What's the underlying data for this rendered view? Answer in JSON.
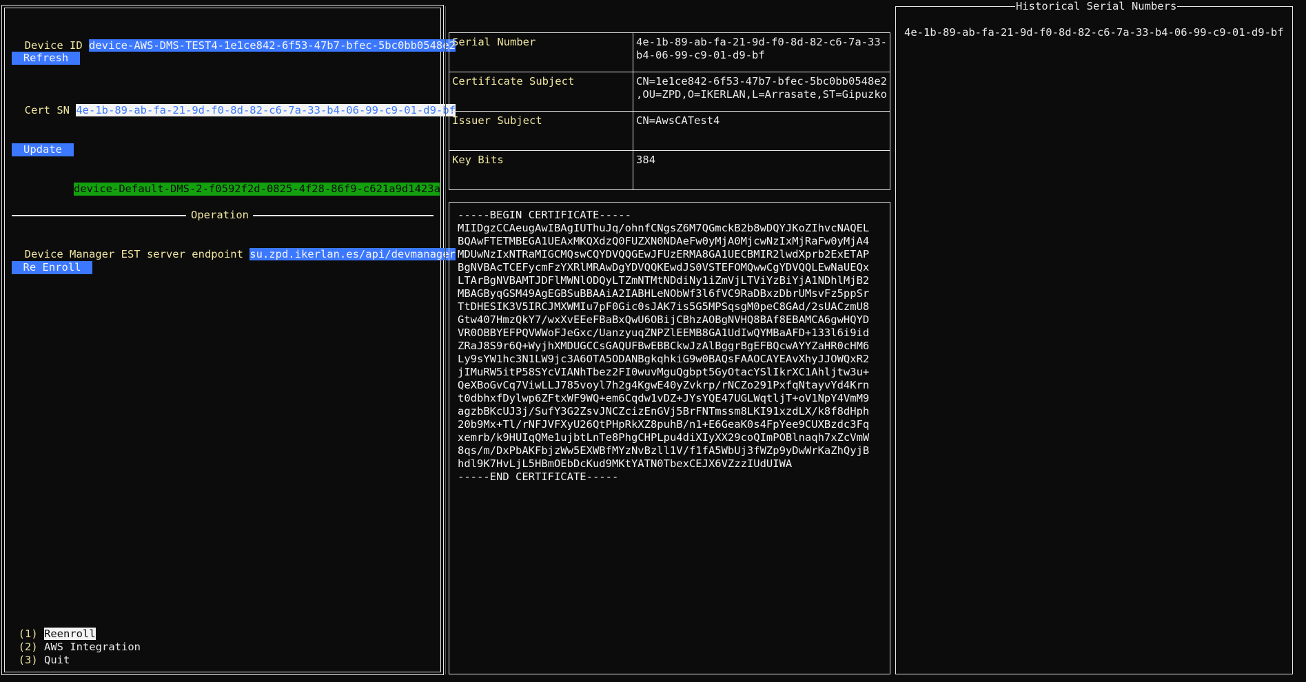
{
  "left": {
    "device_id_label": "Device ID",
    "device_id_value": "device-AWS-DMS-TEST4-1e1ce842-6f53-47b7-bfec-5bc0bb0548e2",
    "refresh_label": "Refresh",
    "cert_sn_label": "Cert SN",
    "cert_sn_value": "4e-1b-89-ab-fa-21-9d-f0-8d-82-c6-7a-33-b4-06-99-c9-01-d9-bf",
    "update_label": "Update",
    "green_value": "device-Default-DMS-2-f0592f2d-0825-4f28-86f9-c621a9d1423a",
    "operation_title": "Operation",
    "endpoint_label": "Device Manager EST server endpoint",
    "endpoint_value": "su.zpd.ikerlan.es/api/devmanager",
    "reenroll_button": "Re Enroll",
    "menu": [
      {
        "key": "(1)",
        "label": "Reenroll"
      },
      {
        "key": "(2)",
        "label": "AWS Integration"
      },
      {
        "key": "(3)",
        "label": "Quit"
      }
    ]
  },
  "info": {
    "rows": [
      {
        "label": "Serial Number",
        "value": "4e-1b-89-ab-fa-21-9d-f0-8d-82-c6-7a-33-\nb4-06-99-c9-01-d9-bf"
      },
      {
        "label": "Certificate Subject",
        "value": "CN=1e1ce842-6f53-47b7-bfec-5bc0bb0548e2\n,OU=ZPD,O=IKERLAN,L=Arrasate,ST=Gipuzko"
      },
      {
        "label": "Issuer Subject",
        "value": "CN=AwsCATest4"
      },
      {
        "label": "Key Bits",
        "value": "384"
      }
    ]
  },
  "certificate": {
    "lines": [
      "-----BEGIN CERTIFICATE-----",
      "MIIDgzCCAeugAwIBAgIUThuJq/ohnfCNgsZ6M7QGmckB2b8wDQYJKoZIhvcNAQEL",
      "BQAwFTETMBEGA1UEAxMKQXdzQ0FUZXN0NDAeFw0yMjA0MjcwNzIxMjRaFw0yMjA4",
      "MDUwNzIxNTRaMIGCMQswCQYDVQQGEwJFUzERMA8GA1UECBMIR2lwdXprb2ExETAP",
      "BgNVBAcTCEFycmFzYXRlMRAwDgYDVQQKEwdJS0VSTEFOMQwwCgYDVQQLEwNaUEQx",
      "LTArBgNVBAMTJDFlMWNlODQyLTZmNTMtNDdiNy1iZmVjLTViYzBiYjA1NDhlMjB2",
      "MBAGByqGSM49AgEGBSuBBAAiA2IABHLeNObWf3l6fVC9RaDBxzDbrUMsvFz5ppSr",
      "TtDHESIK3V5IRCJMXWMIu7pF0Gic0sJAK7is5G5MPSqsgM0peC8GAd/2sUACzmU8",
      "Gtw407HmzQkY7/wxXvEEeFBaBxQwU6OBijCBhzAOBgNVHQ8BAf8EBAMCA6gwHQYD",
      "VR0OBBYEFPQVWWoFJeGxc/UanzyuqZNPZlEEMB8GA1UdIwQYMBaAFD+133l6i9id",
      "ZRaJ8S9r6Q+WyjhXMDUGCCsGAQUFBwEBBCkwJzAlBggrBgEFBQcwAYYZaHR0cHM6",
      "Ly9sYW1hc3N1LW9jc3A6OTA5ODANBgkqhkiG9w0BAQsFAAOCAYEAvXhyJJOWQxR2",
      "jIMuRW5itP58SYcVIANhTbez2FI0wuvMguQgbpt5GyOtacYSlIkrXC1Ahljtw3u+",
      "QeXBoGvCq7ViwLLJ785voyl7h2g4KgwE40yZvkrp/rNCZo291PxfqNtayvYd4Krn",
      "t0dbhxfDylwp6ZFtxWF9WQ+em6Cqdw1vDZ+JYsYQE47UGLWqtljT+oV1NpY4VmM9",
      "agzbBKcUJ3j/SufY3G2ZsvJNCZcizEnGVj5BrFNTmssm8LKI91xzdLX/k8f8dHph",
      "20b9Mx+Tl/rNFJVFXyU26QtPHpRkXZ8puhB/n1+E6GeaK0s4FpYee9CUXBzdc3Fq",
      "xemrb/k9HUIqQMe1ujbtLnTe8PhgCHPLpu4diXIyXX29coQImPOBlnaqh7xZcVmW",
      "8qs/m/DxPbAKFbjzWw5EXWBfMYzNvBzll1V/f1fA5WbUj3fWZp9yDwWrKaZhQyjB",
      "hdl9K7HvLjL5HBmOEbDcKud9MKtYATN0TbexCEJX6VZzzIUdUIWA",
      "-----END CERTIFICATE-----"
    ]
  },
  "history": {
    "title": "Historical Serial Numbers",
    "items": [
      "4e-1b-89-ab-fa-21-9d-f0-8d-82-c6-7a-33-b4-06-99-c9-01-d9-bf"
    ]
  }
}
